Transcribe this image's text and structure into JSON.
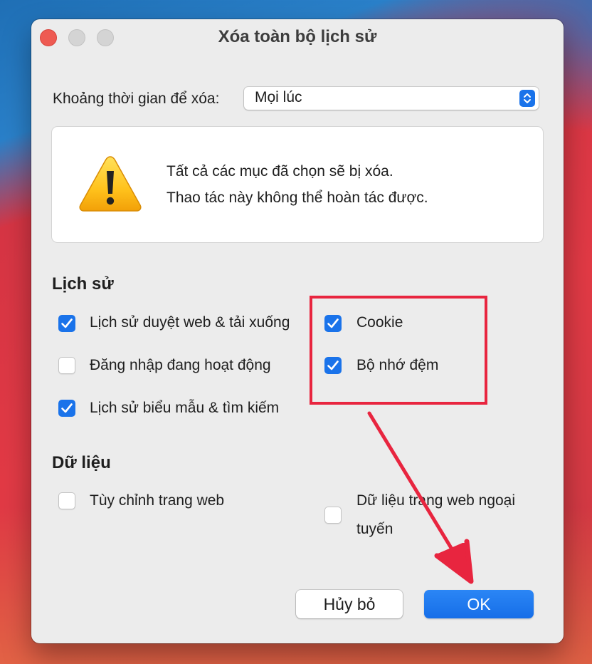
{
  "window": {
    "title": "Xóa toàn bộ lịch sử"
  },
  "time_range": {
    "label": "Khoảng thời gian để xóa:",
    "selected": "Mọi lúc"
  },
  "warning": {
    "line1": "Tất cả các mục đã chọn sẽ bị xóa.",
    "line2": "Thao tác này không thể hoàn tác được."
  },
  "history": {
    "heading": "Lịch sử",
    "items": [
      {
        "label": "Lịch sử duyệt web & tải xuống",
        "checked": true
      },
      {
        "label": "Đăng nhập đang hoạt động",
        "checked": false
      },
      {
        "label": "Lịch sử biểu mẫu & tìm kiếm",
        "checked": true
      },
      {
        "label": "Cookie",
        "checked": true
      },
      {
        "label": "Bộ nhớ đệm",
        "checked": true
      }
    ]
  },
  "data": {
    "heading": "Dữ liệu",
    "items": [
      {
        "label": "Tùy chỉnh trang web",
        "checked": false
      },
      {
        "label_line1": "Dữ liệu trang web ngoại",
        "label_line2": "tuyến",
        "checked": false
      }
    ]
  },
  "buttons": {
    "cancel": "Hủy bỏ",
    "ok": "OK"
  },
  "colors": {
    "accent": "#1a73ea",
    "annotation": "#e8253f",
    "close_light": "#ee5a52"
  }
}
